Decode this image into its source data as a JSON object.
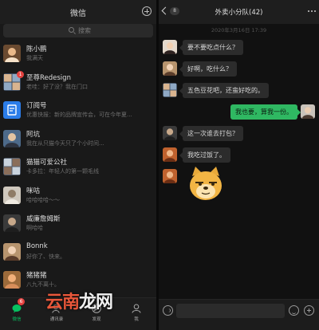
{
  "colors": {
    "accent": "#07c160",
    "badge": "#e64340",
    "bubble_me": "#2fb862",
    "bubble_other": "#2c2c2c",
    "watermark_accent": "#e8573a"
  },
  "left": {
    "title": "微信",
    "plus_icon": "plus-circle-icon",
    "search_placeholder": "搜索",
    "chats": [
      {
        "name": "陈小鹏",
        "preview": "我满天",
        "time": "",
        "badge": "",
        "avatar": "cat"
      },
      {
        "name": "至尊Redesign",
        "preview": "老哇：好了没？我在门口",
        "time": "",
        "badge": "1",
        "avatar": "group"
      },
      {
        "name": "订阅号",
        "preview": "优惠快报：新的品牌宣传会，可在今年夏...",
        "time": "",
        "badge": "",
        "avatar": "subscription"
      },
      {
        "name": "阿坑",
        "preview": "我在从只猫今天只了个小时间...",
        "time": "",
        "badge": "",
        "avatar": "person"
      },
      {
        "name": "猫猫可爱公社",
        "preview": "卡多拉：年轻人的第一颗毛线",
        "time": "",
        "badge": "",
        "avatar": "group2"
      },
      {
        "name": "咪咕",
        "preview": "哈哈哈哈～～",
        "time": "",
        "badge": "",
        "avatar": "dog"
      },
      {
        "name": "威廉詹姆斯",
        "preview": "啊哈哈",
        "time": "",
        "badge": "",
        "avatar": "dark"
      },
      {
        "name": "Bonnk",
        "preview": "好你了、快来。",
        "time": "",
        "badge": "",
        "avatar": "lady"
      },
      {
        "name": "猪猪猪",
        "preview": "八九不离十。",
        "time": "",
        "badge": "",
        "avatar": "pig"
      }
    ],
    "tabs": [
      {
        "label": "微信",
        "icon": "chat-bubble-icon",
        "badge": "6",
        "active": true
      },
      {
        "label": "通讯录",
        "icon": "contacts-icon",
        "badge": "",
        "active": false
      },
      {
        "label": "发现",
        "icon": "compass-icon",
        "badge": "",
        "active": false
      },
      {
        "label": "我",
        "icon": "person-icon",
        "badge": "",
        "active": false
      }
    ]
  },
  "right": {
    "back_count": "8",
    "title": "外卖小分队(42)",
    "more_icon": "more-dots-icon",
    "timestamp": "2020年3月16日 17:39",
    "messages": [
      {
        "text": "要不要吃点什么？",
        "from": "other",
        "avatar": "girl"
      },
      {
        "text": "好啊，吃什么？",
        "from": "other",
        "avatar": "lady"
      },
      {
        "text": "五色豆花吧，还蛮好吃的。",
        "from": "other",
        "avatar": "group"
      },
      {
        "text": "我也要，算我一份。",
        "from": "me",
        "avatar": "me"
      },
      {
        "text": "这一次谁去打包？",
        "from": "other",
        "avatar": "dark"
      },
      {
        "text": "我吃过饭了。",
        "from": "other",
        "avatar": "orange"
      },
      {
        "text": "",
        "from": "other",
        "avatar": "orange",
        "sticker": "doge-sticker"
      }
    ],
    "input": {
      "voice_icon": "voice-icon",
      "emoji_icon": "emoji-icon",
      "add_icon": "add-icon"
    }
  },
  "watermark": {
    "part1": "云南",
    "part2": "龙网"
  }
}
